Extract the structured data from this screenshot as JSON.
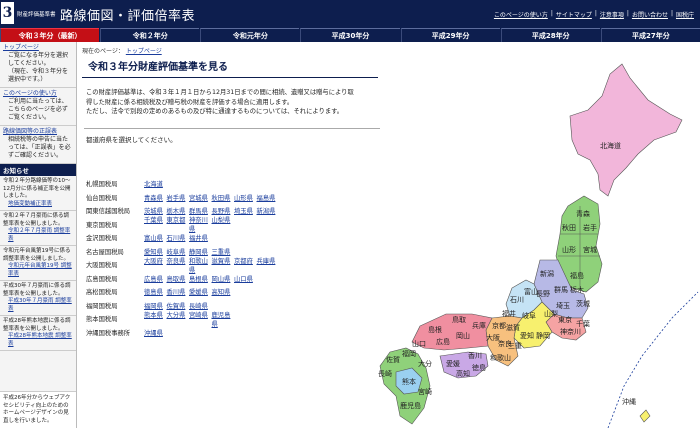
{
  "header": {
    "logo": "3",
    "subtitle": "財産評価基準書",
    "title": "路線価図・評価倍率表",
    "links": [
      "このページの使い方",
      "サイトマップ",
      "注意事項",
      "お問い合わせ",
      "国税庁"
    ]
  },
  "tabs": [
    {
      "label": "令和３年分（最新）",
      "active": true
    },
    {
      "label": "令和２年分",
      "active": false
    },
    {
      "label": "令和元年分",
      "active": false
    },
    {
      "label": "平成30年分",
      "active": false
    },
    {
      "label": "平成29年分",
      "active": false
    },
    {
      "label": "平成28年分",
      "active": false
    },
    {
      "label": "平成27年分",
      "active": false
    }
  ],
  "sidebar": {
    "top": {
      "link": "トップページ",
      "lines": [
        "ご覧になる年分を選択してください。",
        "（現在、令和３年分を選択中です。）"
      ]
    },
    "howto": {
      "link": "このページの使い方",
      "lines": [
        "ご利用に当たっては、こちらのページを必ずご覧ください。"
      ]
    },
    "errata": {
      "link": "路線価図等の正誤表",
      "lines": [
        "相続税等の申告に当たっては、「正誤表」を必ずご確認ください。"
      ]
    },
    "news_title": "お知らせ",
    "news": [
      {
        "text": "令和２年分路線価等の10～12月分に係る補正率を公開しました。",
        "link": "地価変動補正率表"
      },
      {
        "text": "令和２年７月豪雨に係る調整率表を公開しました。",
        "link": "令和２年７月豪雨 調整率表"
      },
      {
        "text": "令和元年台風第19号に係る調整率表を公開しました。",
        "link": "令和元年台風第19号 調整率表"
      },
      {
        "text": "平成30年７月豪雨に係る調整率表を公開しました。",
        "link": "平成30年７月豪雨 調整率表"
      },
      {
        "text": "平成28年熊本地震に係る調整率表を公開しました。",
        "link": "平成28年熊本地震 調整率表"
      }
    ],
    "footer": "平成26年分からウェブアクセシビリティ向上のためのホームページデザインの見直しを行いました。"
  },
  "breadcrumb": {
    "prefix": "現在のページ：",
    "link": "トップページ"
  },
  "page_title": "令和３年分財産評価基準を見る",
  "intro": [
    "この財産評価基準は、令和３年１月１日から12月31日までの間に相続、遺贈又は贈与により取",
    "得した財産に係る相続税及び贈与税の財産を評価する場合に適用します。",
    "ただし、法令で別段の定めのあるもの及び特に通達するものについては、それによります。"
  ],
  "prompt": "都道府県を選択してください。",
  "bureaus": [
    {
      "name": "札幌国税局",
      "prefs": [
        "北海道"
      ]
    },
    {
      "name": "仙台国税局",
      "prefs": [
        "青森県",
        "岩手県",
        "宮城県",
        "秋田県",
        "山形県",
        "福島県"
      ]
    },
    {
      "name": "関東信越国税局",
      "prefs": [
        "茨城県",
        "栃木県",
        "群馬県",
        "長野県",
        "埼玉県",
        "新潟県"
      ]
    },
    {
      "name": "東京国税局",
      "prefs": [
        "千葉県",
        "東京都",
        "神奈川県",
        "山梨県"
      ]
    },
    {
      "name": "金沢国税局",
      "prefs": [
        "富山県",
        "石川県",
        "福井県"
      ]
    },
    {
      "name": "名古屋国税局",
      "prefs": [
        "愛知県",
        "岐阜県",
        "静岡県",
        "三重県"
      ]
    },
    {
      "name": "大阪国税局",
      "prefs": [
        "大阪府",
        "奈良県",
        "和歌山県",
        "滋賀県",
        "京都府",
        "兵庫県"
      ]
    },
    {
      "name": "広島国税局",
      "prefs": [
        "広島県",
        "鳥取県",
        "島根県",
        "岡山県",
        "山口県"
      ]
    },
    {
      "name": "高松国税局",
      "prefs": [
        "徳島県",
        "香川県",
        "愛媛県",
        "高知県"
      ]
    },
    {
      "name": "福岡国税局",
      "prefs": [
        "福岡県",
        "佐賀県",
        "長崎県"
      ]
    },
    {
      "name": "熊本国税局",
      "prefs": [
        "熊本県",
        "大分県",
        "宮崎県",
        "鹿児島県"
      ]
    },
    {
      "name": "沖縄国税事務所",
      "prefs": [
        "沖縄県"
      ]
    }
  ],
  "map": {
    "labels": [
      "北海道",
      "青森",
      "秋田",
      "岩手",
      "山形",
      "宮城",
      "新潟",
      "福島",
      "長野",
      "群馬",
      "栃木",
      "茨城",
      "埼玉",
      "東京",
      "千葉",
      "神奈川",
      "山梨",
      "静岡",
      "愛知",
      "岐阜",
      "富山",
      "石川",
      "福井",
      "滋賀",
      "京都",
      "三重",
      "奈良",
      "大阪",
      "兵庫",
      "和歌山",
      "鳥取",
      "岡山",
      "島根",
      "広島",
      "山口",
      "香川",
      "徳島",
      "愛媛",
      "高知",
      "福岡",
      "佐賀",
      "長崎",
      "大分",
      "熊本",
      "宮崎",
      "鹿児島",
      "沖縄"
    ],
    "colors": {
      "hokkaido": "#f2b6da",
      "tohoku": "#8fd17a",
      "kanto": "#b7b9e6",
      "tokyo": "#f5a3a3",
      "hokuriku": "#c5e3f5",
      "tokai": "#f7f06e",
      "kinki": "#f7c07e",
      "chugoku": "#f08fa0",
      "shikoku": "#c9a8e6",
      "kyushu": "#8fd17a",
      "kumamoto": "#9ad0f0",
      "okinawa": "#f7f06e"
    }
  }
}
